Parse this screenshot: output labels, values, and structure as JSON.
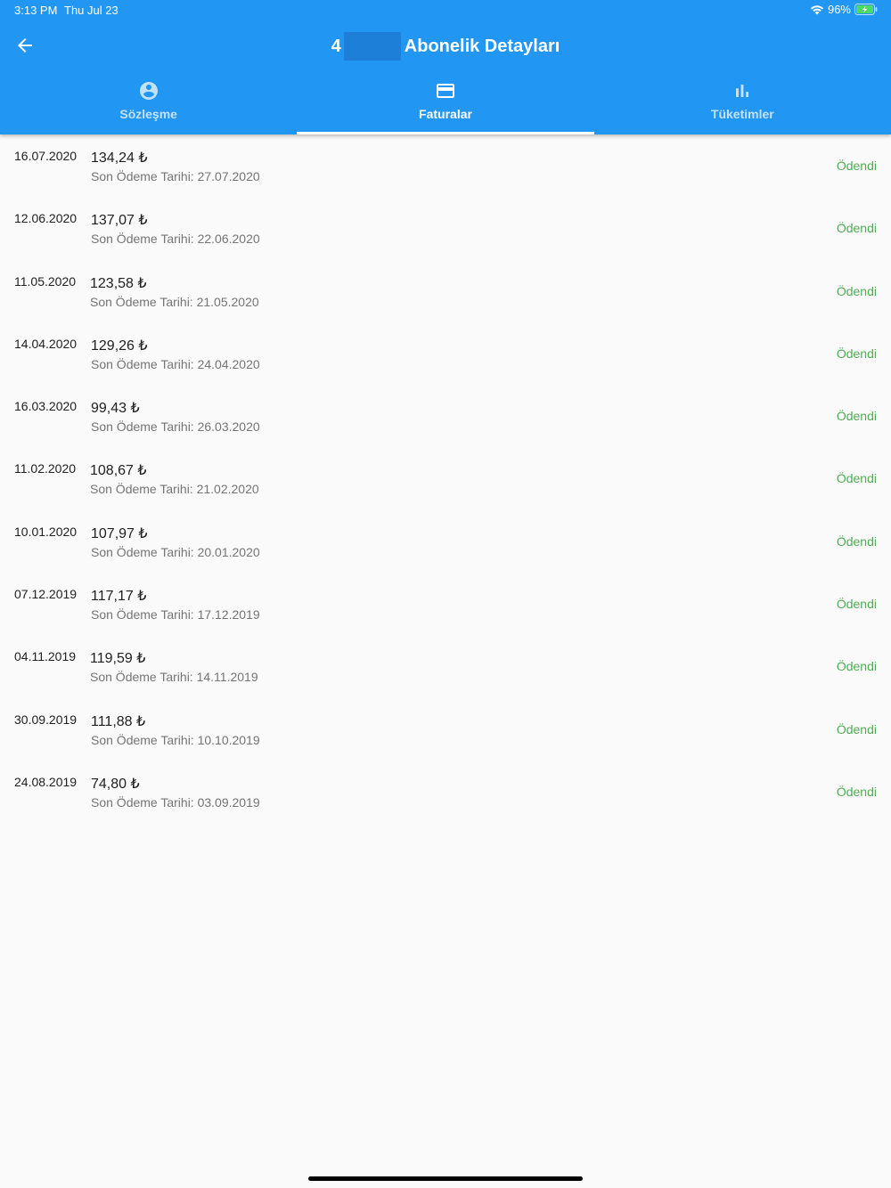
{
  "status_bar": {
    "time": "3:13 PM",
    "date": "Thu Jul 23",
    "battery": "96%"
  },
  "appbar": {
    "title_prefix": "4",
    "title": "Abonelik Detayları"
  },
  "tabs": [
    {
      "label": "Sözleşme",
      "icon": "account-circle-icon",
      "active": false
    },
    {
      "label": "Faturalar",
      "icon": "credit-card-icon",
      "active": true
    },
    {
      "label": "Tüketimler",
      "icon": "bar-chart-icon",
      "active": false
    }
  ],
  "invoices": [
    {
      "date": "16.07.2020",
      "amount": "134,24 ₺",
      "due": "Son Ödeme Tarihi: 27.07.2020",
      "status": "Ödendi"
    },
    {
      "date": "12.06.2020",
      "amount": "137,07 ₺",
      "due": "Son Ödeme Tarihi: 22.06.2020",
      "status": "Ödendi"
    },
    {
      "date": "11.05.2020",
      "amount": "123,58 ₺",
      "due": "Son Ödeme Tarihi: 21.05.2020",
      "status": "Ödendi"
    },
    {
      "date": "14.04.2020",
      "amount": "129,26 ₺",
      "due": "Son Ödeme Tarihi: 24.04.2020",
      "status": "Ödendi"
    },
    {
      "date": "16.03.2020",
      "amount": "99,43 ₺",
      "due": "Son Ödeme Tarihi: 26.03.2020",
      "status": "Ödendi"
    },
    {
      "date": "11.02.2020",
      "amount": "108,67 ₺",
      "due": "Son Ödeme Tarihi: 21.02.2020",
      "status": "Ödendi"
    },
    {
      "date": "10.01.2020",
      "amount": "107,97 ₺",
      "due": "Son Ödeme Tarihi: 20.01.2020",
      "status": "Ödendi"
    },
    {
      "date": "07.12.2019",
      "amount": "117,17 ₺",
      "due": "Son Ödeme Tarihi: 17.12.2019",
      "status": "Ödendi"
    },
    {
      "date": "04.11.2019",
      "amount": "119,59 ₺",
      "due": "Son Ödeme Tarihi: 14.11.2019",
      "status": "Ödendi"
    },
    {
      "date": "30.09.2019",
      "amount": "111,88 ₺",
      "due": "Son Ödeme Tarihi: 10.10.2019",
      "status": "Ödendi"
    },
    {
      "date": "24.08.2019",
      "amount": "74,80 ₺",
      "due": "Son Ödeme Tarihi: 03.09.2019",
      "status": "Ödendi"
    }
  ],
  "colors": {
    "primary": "#2196f3",
    "paid": "#4caf50",
    "background": "#fafafa"
  }
}
